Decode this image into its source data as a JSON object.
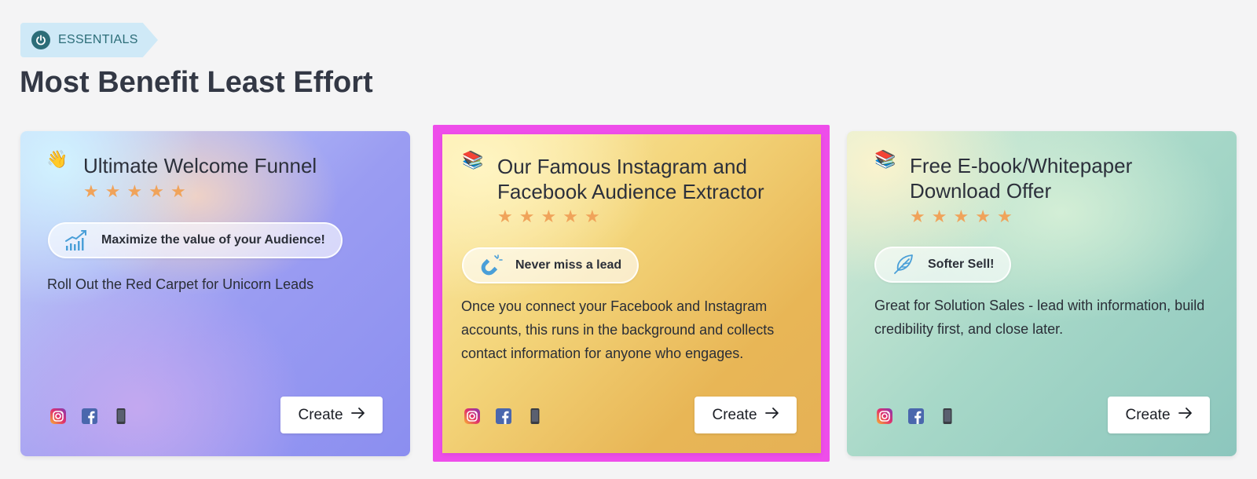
{
  "section": {
    "tag_label": "ESSENTIALS",
    "tag_icon": "power-icon",
    "title": "Most Benefit Least Effort"
  },
  "cards": [
    {
      "emoji": "👋",
      "emoji_icon": "waving-hand-icon",
      "title": "Ultimate Welcome Funnel",
      "rating": 5,
      "stars": [
        "★",
        "★",
        "★",
        "★",
        "★"
      ],
      "pill_icon": "growth-chart-icon",
      "pill_label": "Maximize the value of your Audience!",
      "description": "Roll Out the Red Carpet for Unicorn Leads",
      "social_icons": [
        "instagram-icon",
        "facebook-icon",
        "phone-icon"
      ],
      "button_label": "Create",
      "selected": false
    },
    {
      "emoji": "📚",
      "emoji_icon": "books-icon",
      "title": "Our Famous Instagram and Facebook Audience Extractor",
      "rating": 5,
      "stars": [
        "★",
        "★",
        "★",
        "★",
        "★"
      ],
      "pill_icon": "magnet-icon",
      "pill_label": "Never miss a lead",
      "description": "Once you connect your Facebook and Instagram accounts, this runs in the background and collects contact information for anyone who engages.",
      "social_icons": [
        "instagram-icon",
        "facebook-icon",
        "phone-icon"
      ],
      "button_label": "Create",
      "selected": true
    },
    {
      "emoji": "📚",
      "emoji_icon": "books-icon",
      "title": "Free E-book/Whitepaper Download Offer",
      "rating": 5,
      "stars": [
        "★",
        "★",
        "★",
        "★",
        "★"
      ],
      "pill_icon": "feather-icon",
      "pill_label": "Softer Sell!",
      "description": "Great for Solution Sales - lead with information, build credibility first, and close later.",
      "social_icons": [
        "instagram-icon",
        "facebook-icon",
        "phone-icon"
      ],
      "button_label": "Create",
      "selected": false
    }
  ],
  "colors": {
    "selected_outline": "#ee4dea",
    "star": "#f0a35a",
    "tag_bg": "#cfe9f7",
    "tag_fg": "#2c6d78"
  }
}
